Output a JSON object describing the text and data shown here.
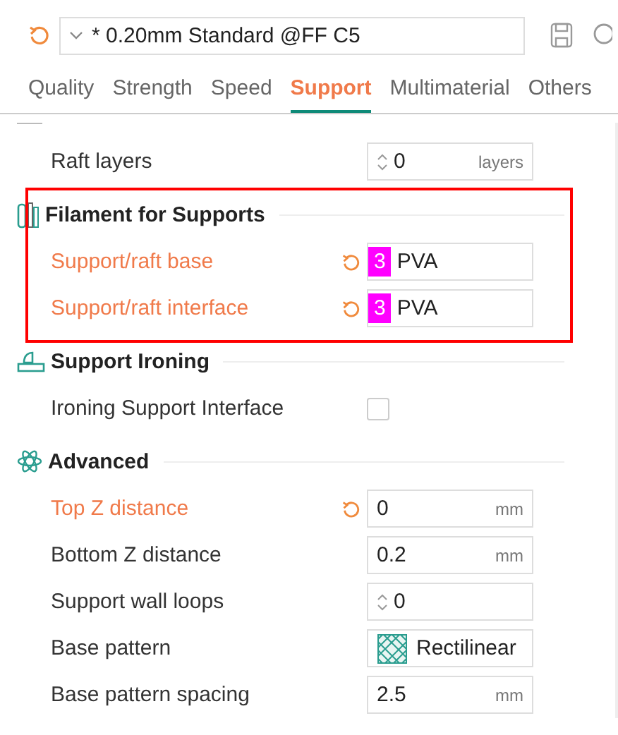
{
  "preset": {
    "name": "* 0.20mm Standard @FF C5",
    "modified": true
  },
  "tabs": [
    {
      "label": "Quality",
      "selected": false
    },
    {
      "label": "Strength",
      "selected": false
    },
    {
      "label": "Speed",
      "selected": false
    },
    {
      "label": "Support",
      "selected": true
    },
    {
      "label": "Multimaterial",
      "selected": false
    },
    {
      "label": "Others",
      "selected": false
    }
  ],
  "groups": [
    {
      "highlighted": false,
      "rows": [
        {
          "kind": "spin",
          "label": "Raft layers",
          "modified": false,
          "value": "0",
          "unit": "layers"
        }
      ]
    },
    {
      "title": "Filament for Supports",
      "highlighted": true,
      "rows": [
        {
          "kind": "filament",
          "label": "Support/raft base",
          "modified": true,
          "index": "3",
          "value": "PVA",
          "color": "#ff00ff"
        },
        {
          "kind": "filament",
          "label": "Support/raft interface",
          "modified": true,
          "index": "3",
          "value": "PVA",
          "color": "#ff00ff"
        }
      ]
    },
    {
      "title": "Support Ironing",
      "highlighted": false,
      "rows": [
        {
          "kind": "checkbox",
          "label": "Ironing Support Interface",
          "modified": false,
          "checked": false
        }
      ]
    },
    {
      "title": "Advanced",
      "highlighted": false,
      "rows": [
        {
          "kind": "number",
          "label": "Top Z distance",
          "modified": true,
          "value": "0",
          "unit": "mm"
        },
        {
          "kind": "number",
          "label": "Bottom Z distance",
          "modified": false,
          "value": "0.2",
          "unit": "mm"
        },
        {
          "kind": "spin",
          "label": "Support wall loops",
          "modified": false,
          "value": "0",
          "unit": ""
        },
        {
          "kind": "pattern",
          "label": "Base pattern",
          "modified": false,
          "value": "Rectilinear"
        },
        {
          "kind": "number",
          "label": "Base pattern spacing",
          "modified": false,
          "value": "2.5",
          "unit": "mm"
        }
      ]
    }
  ]
}
